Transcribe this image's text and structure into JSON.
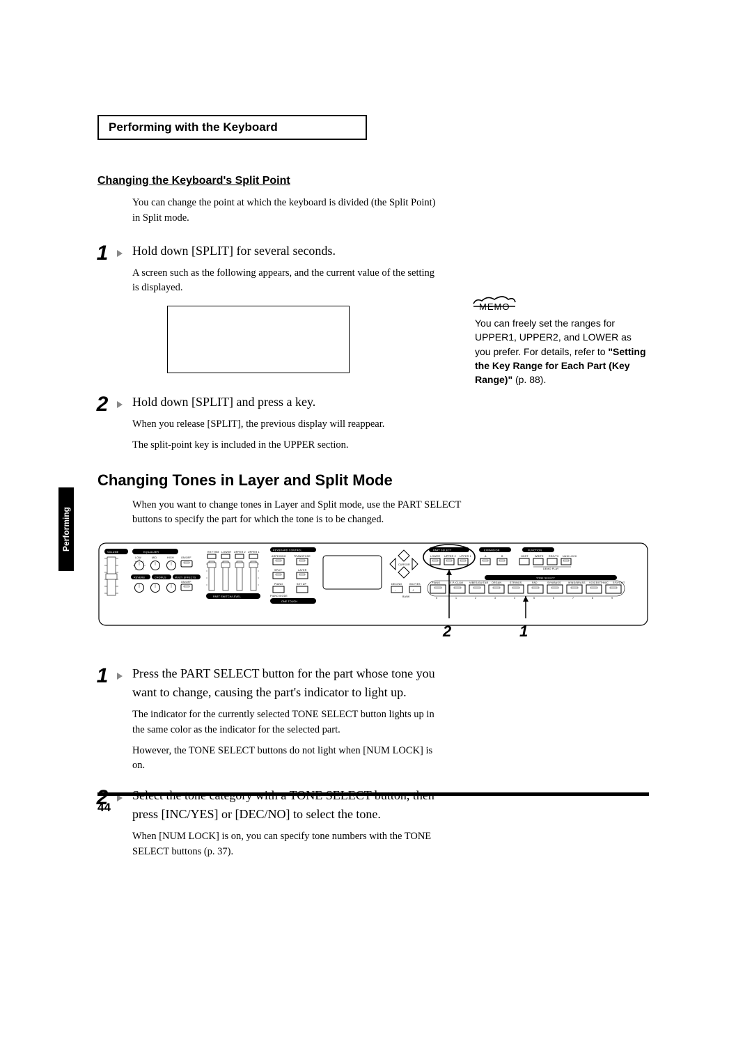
{
  "header": {
    "title": "Performing with the Keyboard"
  },
  "sec1": {
    "subhead": "Changing the Keyboard's Split Point",
    "intro": "You can change the point at which the keyboard is divided (the Split Point) in Split mode.",
    "step1": {
      "num": "1",
      "instr": "Hold down [SPLIT] for several seconds.",
      "note": "A screen such as the following appears, and the current value of the setting is displayed."
    },
    "step2": {
      "num": "2",
      "instr": "Hold down [SPLIT] and press a key.",
      "note1": "When you release [SPLIT], the previous display will reappear.",
      "note2": "The split-point key is included in the UPPER section."
    }
  },
  "sec2": {
    "title": "Changing Tones in Layer and Split Mode",
    "intro": "When you want to change tones in Layer and Split mode, use the PART SELECT buttons to specify the part for which the tone is to be changed.",
    "step1": {
      "num": "1",
      "instr": "Press the PART SELECT button for the part whose tone you want to change, causing the part's indicator to light up.",
      "note1": "The indicator for the currently selected TONE SELECT button lights up in the same color as the indicator for the selected part.",
      "note2": "However, the TONE SELECT buttons do not light when [NUM LOCK] is on."
    },
    "step2": {
      "num": "2",
      "instr": "Select the tone category with a TONE SELECT button, then press [INC/YES] or [DEC/NO] to select the tone.",
      "note": "When [NUM LOCK] is on, you can specify tone numbers with the TONE SELECT buttons (p. 37)."
    }
  },
  "memo": {
    "label": "MEMO",
    "body_pre": "You can freely set the ranges for UPPER1, UPPER2, and LOWER as you prefer. For details, refer to ",
    "body_bold": "\"Setting the Key Range for Each Part (Key Range)\"",
    "body_post": " (p. 88)."
  },
  "side_tab": "Performing",
  "panel_callouts": {
    "c1": "1",
    "c2": "2"
  },
  "panel_labels": {
    "volume": "VOLUME",
    "equalizer": "EQUALIZER",
    "low": "LOW",
    "mid": "MID",
    "high": "HIGH",
    "onoff": "ON/OFF",
    "reverb": "REVERB",
    "chorus": "CHORUS",
    "multi": "MULTI EFFECTS",
    "rhythm": "RHYTHM",
    "lower": "LOWER",
    "upper2": "UPPER 2",
    "upper1": "UPPER 1",
    "partswlvl": "PART SWITCH/LEVEL",
    "kbctrl": "KEYBOARD CONTROL",
    "arpeggio": "ARPEGGIO",
    "transpose": "TRANSPOSE",
    "split": "SPLIT",
    "layer": "LAYER",
    "piano": "PIANO",
    "setup": "SET UP",
    "pianomode": "PIANO MODE",
    "onetouch": "ONE TOUCH",
    "cursor": "CURSOR",
    "decno": "DEC/NO",
    "incyes": "INC/YES",
    "partselect": "PART SELECT",
    "expansion": "EXPANSION",
    "function": "FUNCTION",
    "ps_lower": "LOWER",
    "ps_upper2": "UPPER 2",
    "ps_upper1": "UPPER 1",
    "exp_a": "A",
    "exp_b": "B",
    "fn_host": "HOST",
    "fn_write": "WRITE",
    "fn_regtx": "REG/TX",
    "fn_numlock": "NUM LOCK",
    "demoplay": "DEMO PLAY",
    "toneselect": "TONE SELECT",
    "ts0": "PIANO",
    "ts1": "E.P./CLAVI",
    "ts2": "VIBES/GUITAR",
    "ts3": "ORGAN",
    "ts4": "STRINGS",
    "ts5": "PAD",
    "ts6": "SYN/BASS",
    "ts7": "WIND/BRASS",
    "ts8": "VOICE/ETHNIC",
    "ts9": "SFX/GMT",
    "bank": "BANK",
    "n0": "0",
    "n1": "1",
    "n2": "2",
    "n3": "3",
    "n4": "4",
    "n5": "5",
    "n6": "6",
    "n7": "7",
    "n8": "8",
    "n9": "9"
  },
  "page_number": "44"
}
